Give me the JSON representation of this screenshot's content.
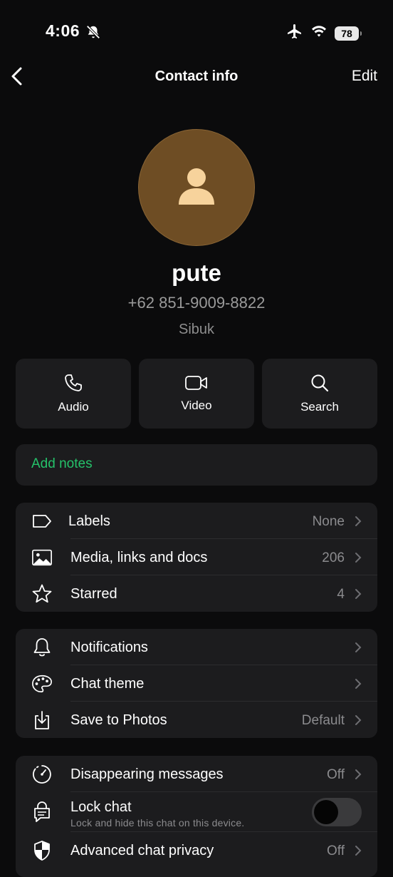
{
  "status": {
    "time": "4:06",
    "battery": "78"
  },
  "nav": {
    "title": "Contact info",
    "edit": "Edit"
  },
  "contact": {
    "name": "pute",
    "phone": "+62 851-9009-8822",
    "subtitle": "Sibuk"
  },
  "actions": [
    {
      "label": "Audio",
      "icon": "phone-icon"
    },
    {
      "label": "Video",
      "icon": "video-icon"
    },
    {
      "label": "Search",
      "icon": "search-icon"
    }
  ],
  "notes": {
    "label": "Add notes"
  },
  "group1": [
    {
      "label": "Labels",
      "value": "None"
    },
    {
      "label": "Media, links and docs",
      "value": "206"
    },
    {
      "label": "Starred",
      "value": "4"
    }
  ],
  "group2": [
    {
      "label": "Notifications",
      "value": ""
    },
    {
      "label": "Chat theme",
      "value": ""
    },
    {
      "label": "Save to Photos",
      "value": "Default"
    }
  ],
  "group3": [
    {
      "label": "Disappearing messages",
      "value": "Off"
    },
    {
      "label": "Lock chat",
      "sub": "Lock and hide this chat on this device.",
      "toggle": false
    },
    {
      "label": "Advanced chat privacy",
      "value": "Off"
    }
  ],
  "colors": {
    "accent_green": "#25c26a",
    "avatar_bg": "#6e4d24",
    "card_bg": "#1c1c1e"
  }
}
